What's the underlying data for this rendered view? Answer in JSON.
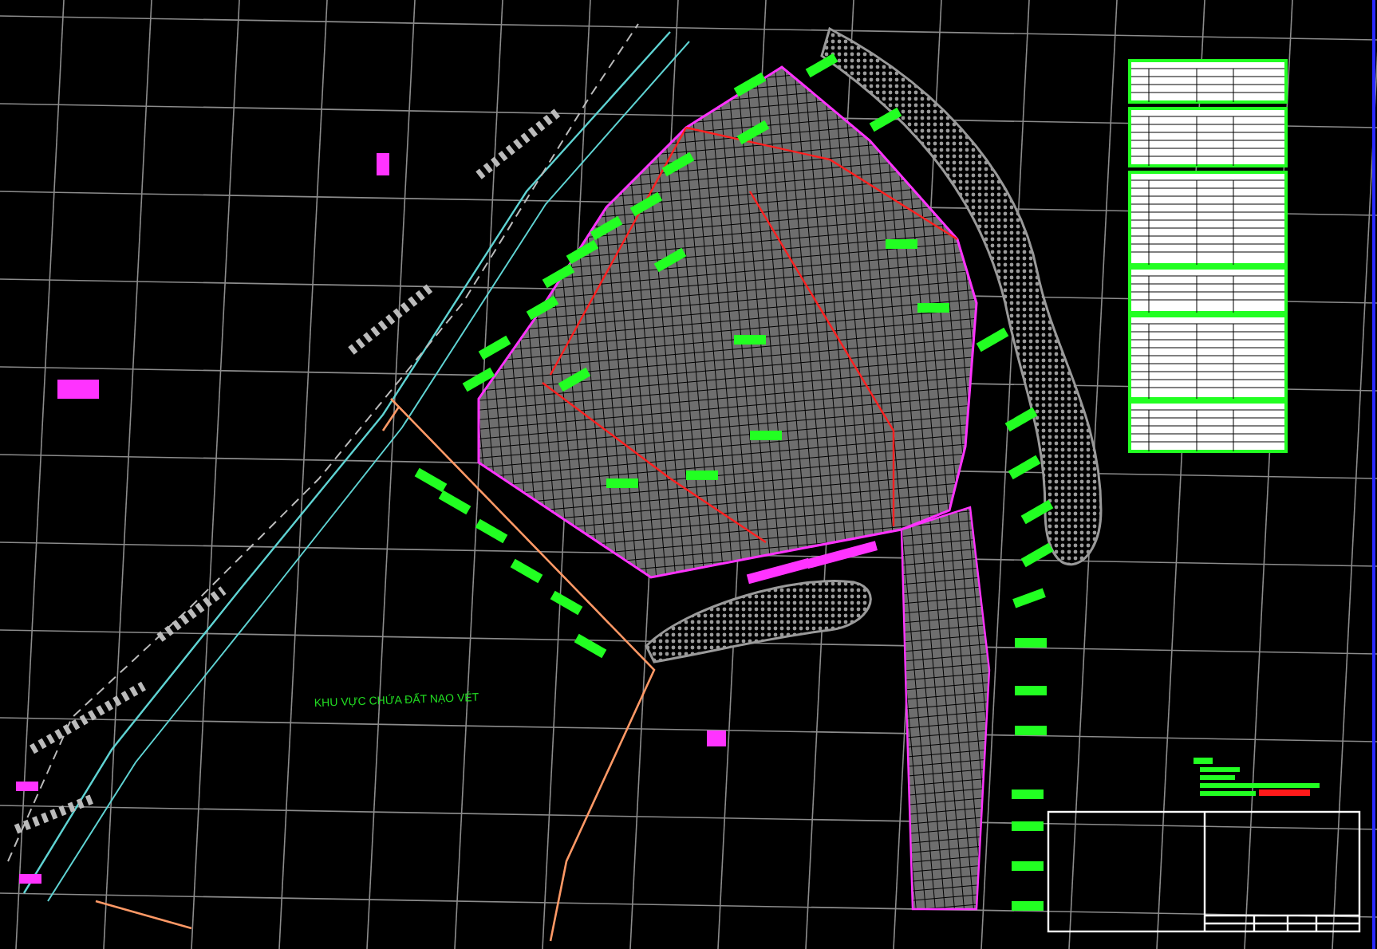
{
  "drawing": {
    "zone_label": "KHU VỰC CHỨA ĐẤT NẠO VÉT"
  }
}
